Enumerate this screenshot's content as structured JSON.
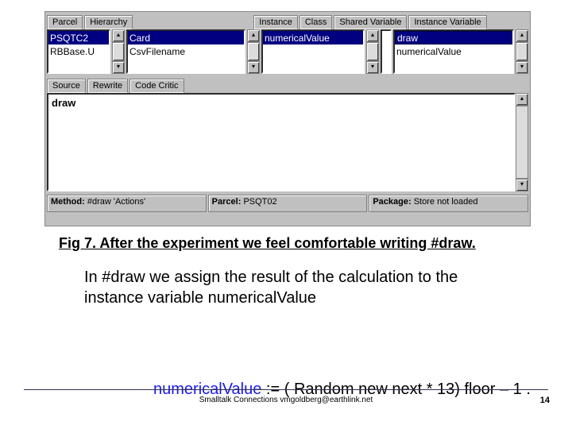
{
  "ide": {
    "tabs_top_left": [
      "Parcel",
      "Hierarchy"
    ],
    "tabs_top_right": [
      "Instance",
      "Class",
      "Shared Variable",
      "Instance Variable"
    ],
    "parcel_list": {
      "items": [
        "PSQTC2",
        "RBBase.U"
      ],
      "selected_index": 0
    },
    "class_list": {
      "items": [
        "Card",
        "CsvFilename"
      ],
      "selected_index": 0
    },
    "protocol_list": {
      "items": [
        "numericalValue"
      ],
      "selected_index": 0
    },
    "method_list": {
      "items": [
        "draw",
        "numericalValue"
      ],
      "selected_index": 0
    },
    "tabs_mid": [
      "Source",
      "Rewrite",
      "Code Critic"
    ],
    "code": {
      "method_name": "draw",
      "body_lhs": "numericalValue",
      "body_rhs": " := ( Random new  next * 13) floor – 1 ."
    },
    "status": {
      "method_label": "Method:",
      "method_value": "#draw 'Actions'",
      "parcel_label": "Parcel:",
      "parcel_value": "PSQT02",
      "package_label": "Package:",
      "package_value": "Store not loaded"
    }
  },
  "caption": "Fig 7.  After the experiment we feel comfortable writing #draw.",
  "body_text": "In #draw we assign the result of the calculation to the instance variable numericalValue",
  "footer": "Smalltalk Connections  vmgoldberg@earthlink.net",
  "page": "14"
}
